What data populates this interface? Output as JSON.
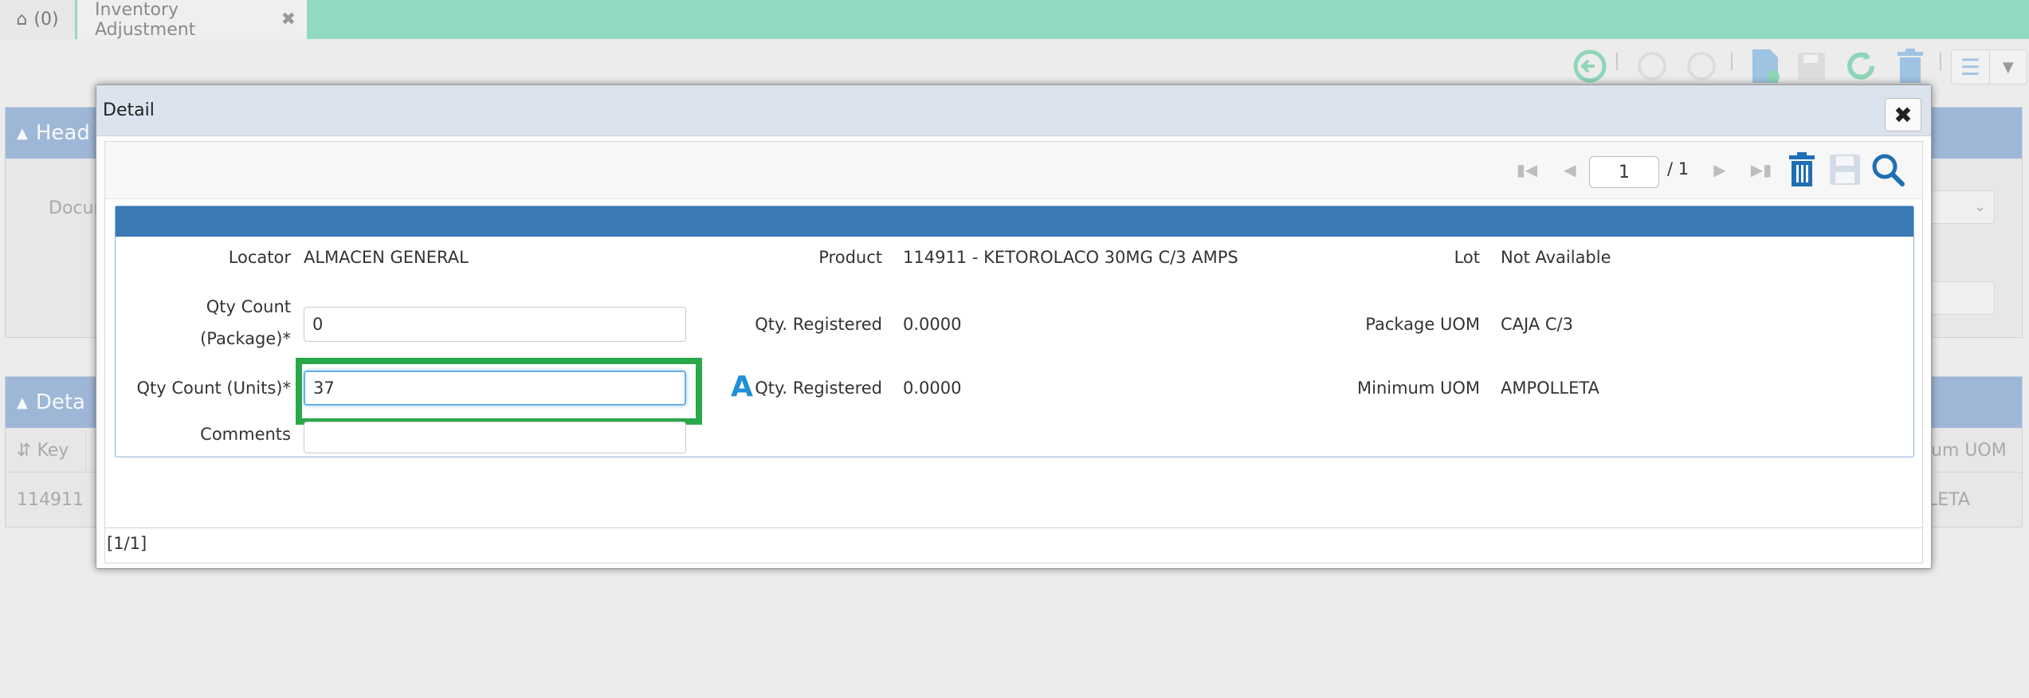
{
  "tabs": {
    "home_count": "(0)",
    "active_title": "Inventory Adjustment"
  },
  "background": {
    "header_panel_title": "Head",
    "document_label": "Docum",
    "detail_panel_title": "Deta",
    "col_key": "Key",
    "col_min_uom": "num UOM",
    "row_key": "114911",
    "row_min_uom": "LETA"
  },
  "modal": {
    "title": "Detail",
    "page_current": "1",
    "page_total": "/ 1",
    "status": "[1/1]",
    "marker": "A",
    "fields": {
      "locator_label": "Locator",
      "locator_value": "ALMACEN GENERAL",
      "product_label": "Product",
      "product_value": "114911 - KETOROLACO 30MG C/3 AMPS",
      "lot_label": "Lot",
      "lot_value": "Not Available",
      "qty_package_label_1": "Qty Count",
      "qty_package_label_2": "(Package)*",
      "qty_package_value": "0",
      "qty_registered_label_1": "Qty. Registered",
      "qty_registered_value_1": "0.0000",
      "package_uom_label": "Package UOM",
      "package_uom_value": "CAJA C/3",
      "qty_units_label": "Qty Count (Units)*",
      "qty_units_value": "37",
      "qty_registered_label_2": "Qty. Registered",
      "qty_registered_value_2": "0.0000",
      "min_uom_label": "Minimum UOM",
      "min_uom_value": "AMPOLLETA",
      "comments_label": "Comments",
      "comments_value": ""
    }
  },
  "colors": {
    "topbar": "#92d9c3",
    "form_header": "#3b7ab5",
    "highlight": "#2aa84a",
    "accent_blue": "#1f6fb5"
  },
  "icons": [
    "home-icon",
    "close-icon",
    "back-icon",
    "first-page-icon",
    "prev-page-icon",
    "next-page-icon",
    "last-page-icon",
    "trash-icon",
    "save-icon",
    "search-icon",
    "refresh-icon",
    "new-document-icon",
    "list-icon",
    "caret-down-icon"
  ]
}
